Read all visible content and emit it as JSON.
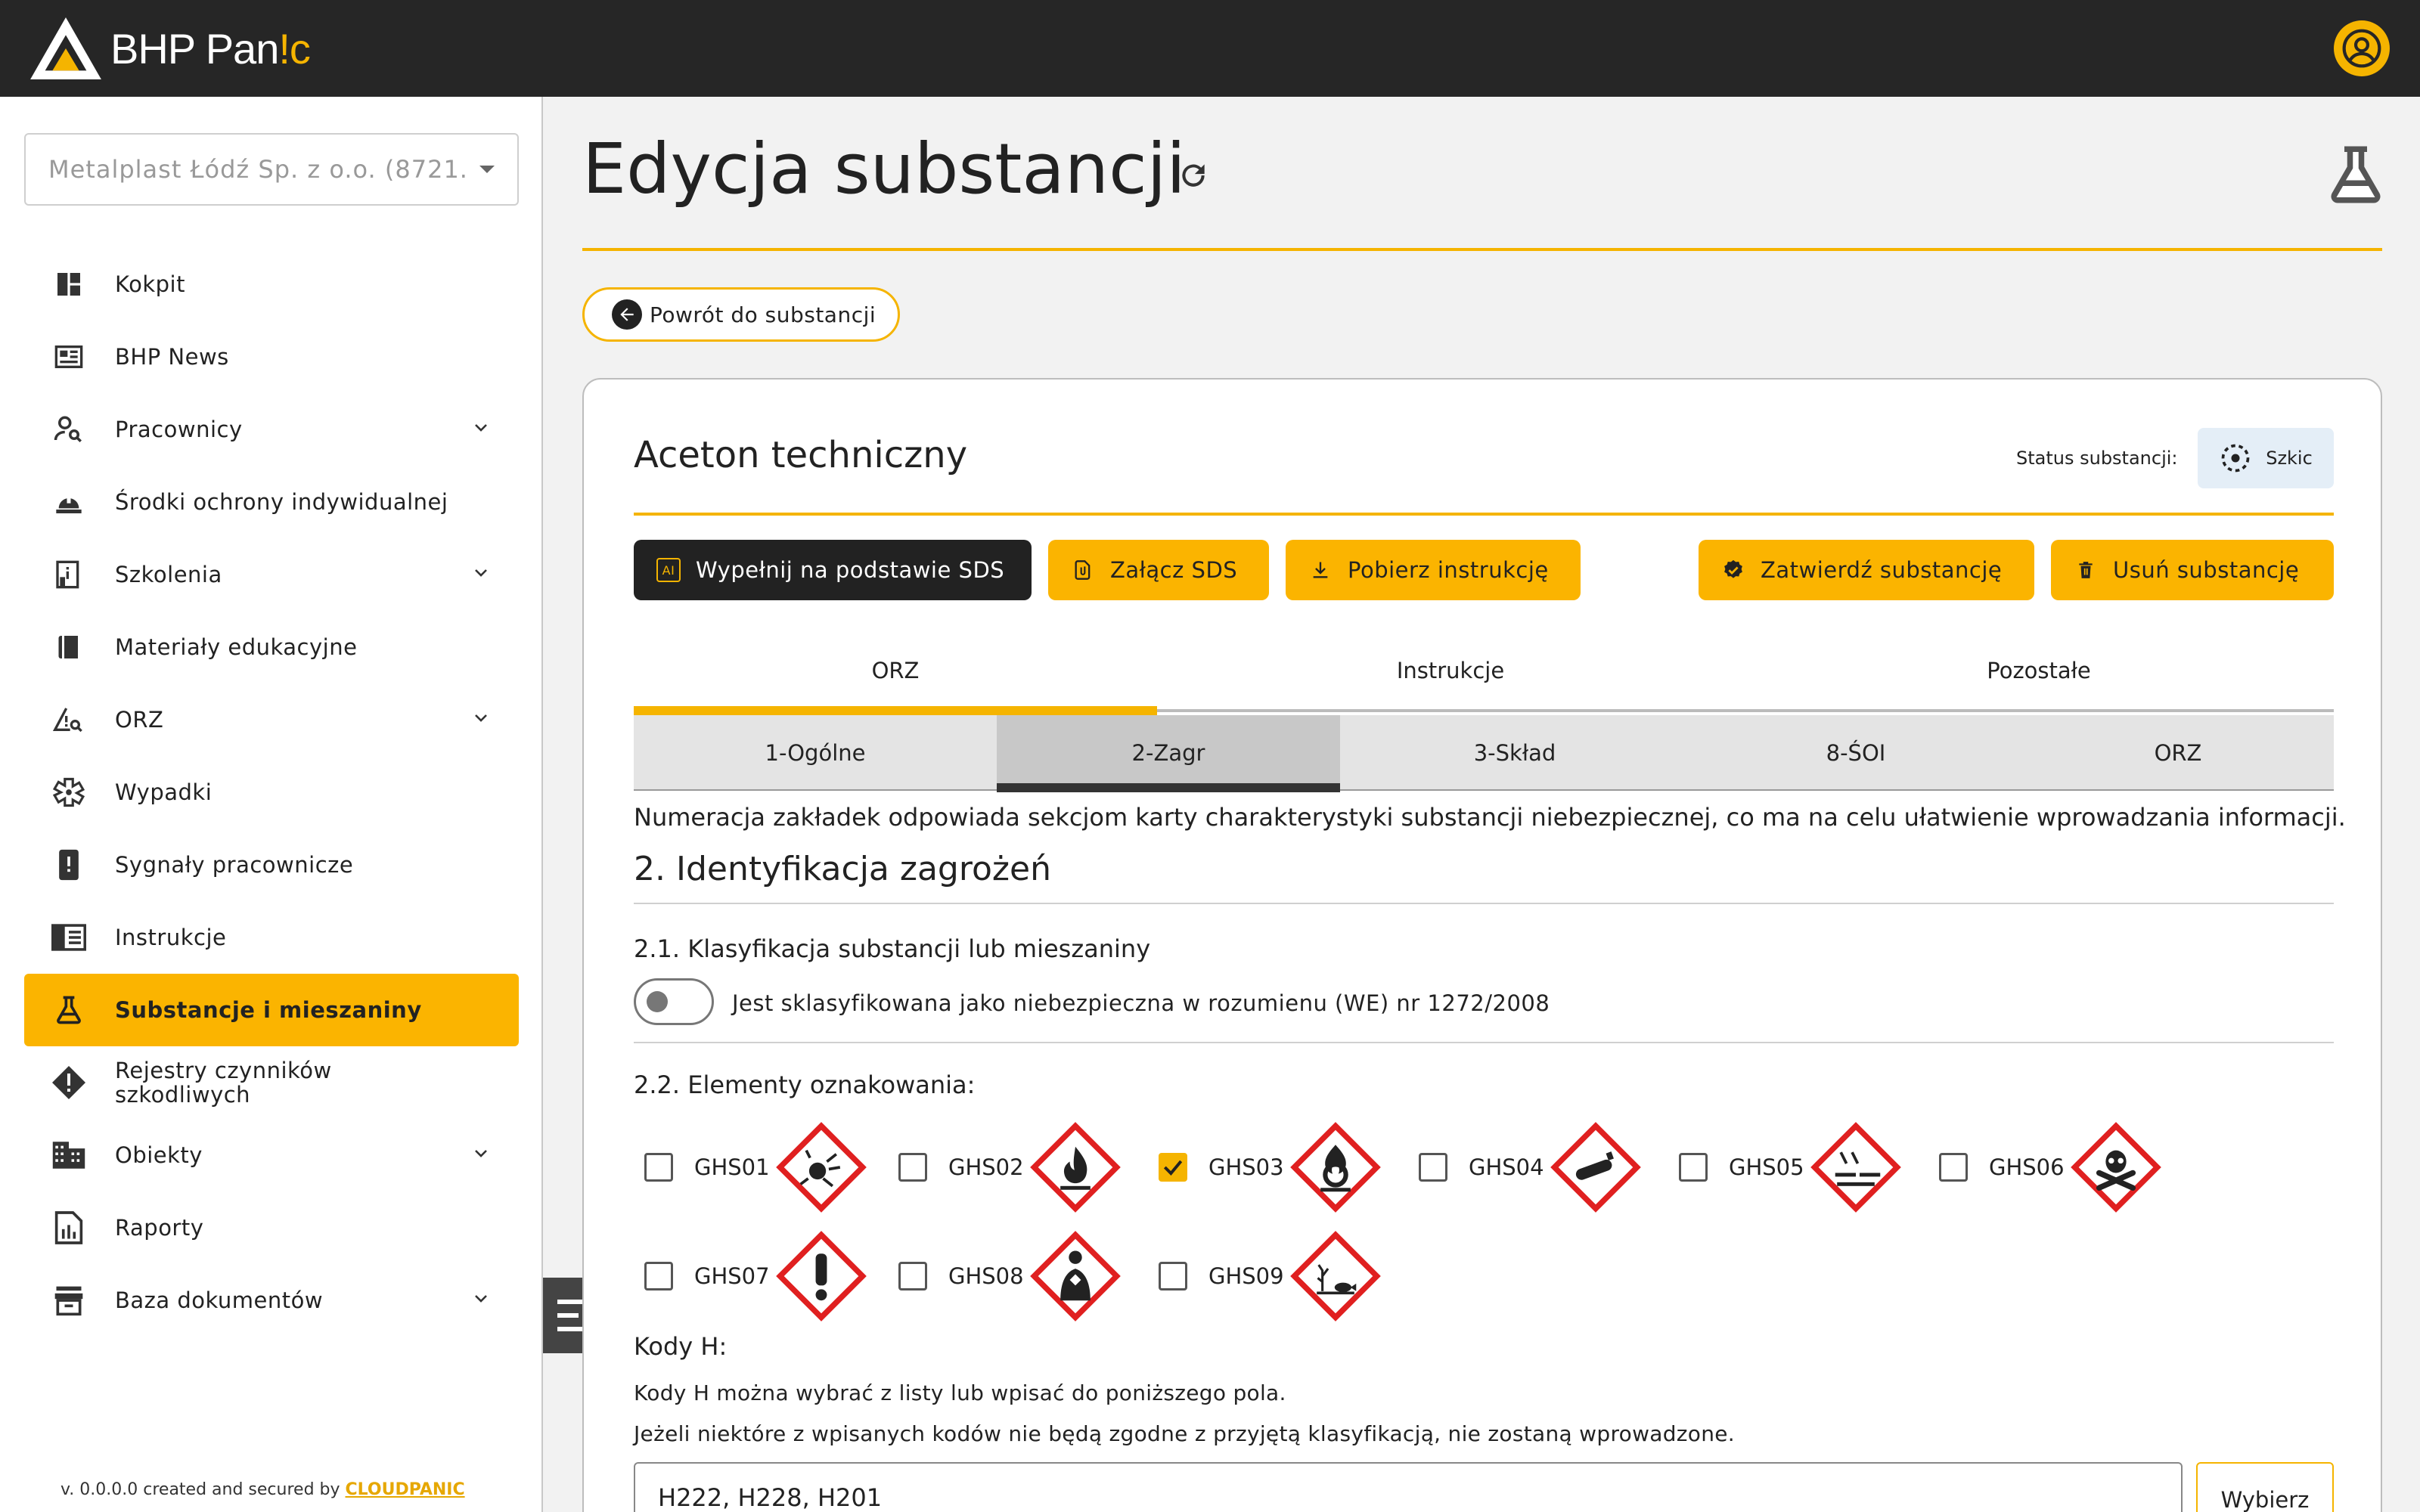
{
  "app": {
    "logo_main": "BHP Pan",
    "logo_accent": "!c"
  },
  "sidebar": {
    "company_select": "Metalplast Łódź Sp. z o.o. (8721...",
    "items": [
      {
        "label": "Kokpit",
        "icon": "dashboard-icon",
        "expandable": false,
        "active": false
      },
      {
        "label": "BHP News",
        "icon": "news-icon",
        "expandable": false,
        "active": false
      },
      {
        "label": "Pracownicy",
        "icon": "person-search-icon",
        "expandable": true,
        "active": false
      },
      {
        "label": "Środki ochrony indywidualnej",
        "icon": "hard-hat-icon",
        "expandable": false,
        "active": false
      },
      {
        "label": "Szkolenia",
        "icon": "training-icon",
        "expandable": true,
        "active": false
      },
      {
        "label": "Materiały edukacyjne",
        "icon": "book-icon",
        "expandable": false,
        "active": false
      },
      {
        "label": "ORZ",
        "icon": "risk-warning-icon",
        "expandable": true,
        "active": false
      },
      {
        "label": "Wypadki",
        "icon": "medical-icon",
        "expandable": false,
        "active": false
      },
      {
        "label": "Sygnały pracownicze",
        "icon": "alert-phone-icon",
        "expandable": false,
        "active": false
      },
      {
        "label": "Instrukcje",
        "icon": "instructions-icon",
        "expandable": false,
        "active": false
      },
      {
        "label": "Substancje i mieszaniny",
        "icon": "flask-icon",
        "expandable": false,
        "active": true
      },
      {
        "label": "Rejestry czynników szkodliwych",
        "icon": "alert-diamond-icon",
        "expandable": false,
        "active": false
      },
      {
        "label": "Obiekty",
        "icon": "building-icon",
        "expandable": true,
        "active": false
      },
      {
        "label": "Raporty",
        "icon": "report-icon",
        "expandable": false,
        "active": false
      },
      {
        "label": "Baza dokumentów",
        "icon": "archive-icon",
        "expandable": true,
        "active": false
      }
    ],
    "version_text": "v. 0.0.0.0 created and secured by ",
    "version_link": "CLOUDPANIC"
  },
  "page": {
    "title": "Edycja substancji",
    "back_button": "Powrót do substancji"
  },
  "substance": {
    "name": "Aceton techniczny",
    "status_label": "Status substancji:",
    "status_value": "Szkic"
  },
  "actions": {
    "fill_sds": "Wypełnij na podstawie SDS",
    "fill_sds_badge": "AI",
    "attach_sds": "Załącz SDS",
    "download": "Pobierz instrukcję",
    "approve": "Zatwierdź substancję",
    "delete": "Usuń substancję"
  },
  "tabs_main": [
    "ORZ",
    "Instrukcje",
    "Pozostałe"
  ],
  "tabs_sub": [
    "1-Ogólne",
    "2-Zagr",
    "3-Skład",
    "8-ŚOI",
    "ORZ"
  ],
  "section": {
    "note": "Numeracja zakładek odpowiada sekcjom karty charakterystyki substancji niebezpiecznej, co ma na celu ułatwienie wprowadzania informacji.",
    "title": "2. Identyfikacja zagrożeń",
    "sub1": "2.1. Klasyfikacja substancji lub mieszaniny",
    "toggle_label": "Jest sklasyfikowana jako niebezpieczna w rozumienu (WE) nr 1272/2008",
    "sub2": "2.2. Elementy oznakowania:"
  },
  "ghs": [
    {
      "label": "GHS01",
      "checked": false
    },
    {
      "label": "GHS02",
      "checked": false
    },
    {
      "label": "GHS03",
      "checked": true
    },
    {
      "label": "GHS04",
      "checked": false
    },
    {
      "label": "GHS05",
      "checked": false
    },
    {
      "label": "GHS06",
      "checked": false
    },
    {
      "label": "GHS07",
      "checked": false
    },
    {
      "label": "GHS08",
      "checked": false
    },
    {
      "label": "GHS09",
      "checked": false
    }
  ],
  "kody": {
    "title": "Kody H:",
    "p1": "Kody H można wybrać z listy lub wpisać do poniższego pola.",
    "p2": "Jeżeli niektóre z wpisanych kodów nie będą zgodne z przyjętą klasyfikacją, nie zostaną wprowadzone.",
    "value": "H222, H228, H201",
    "choose_button": "Wybierz"
  },
  "colors": {
    "accent": "#f5b400",
    "topbar": "#262626",
    "ghs_red": "#e02020"
  }
}
